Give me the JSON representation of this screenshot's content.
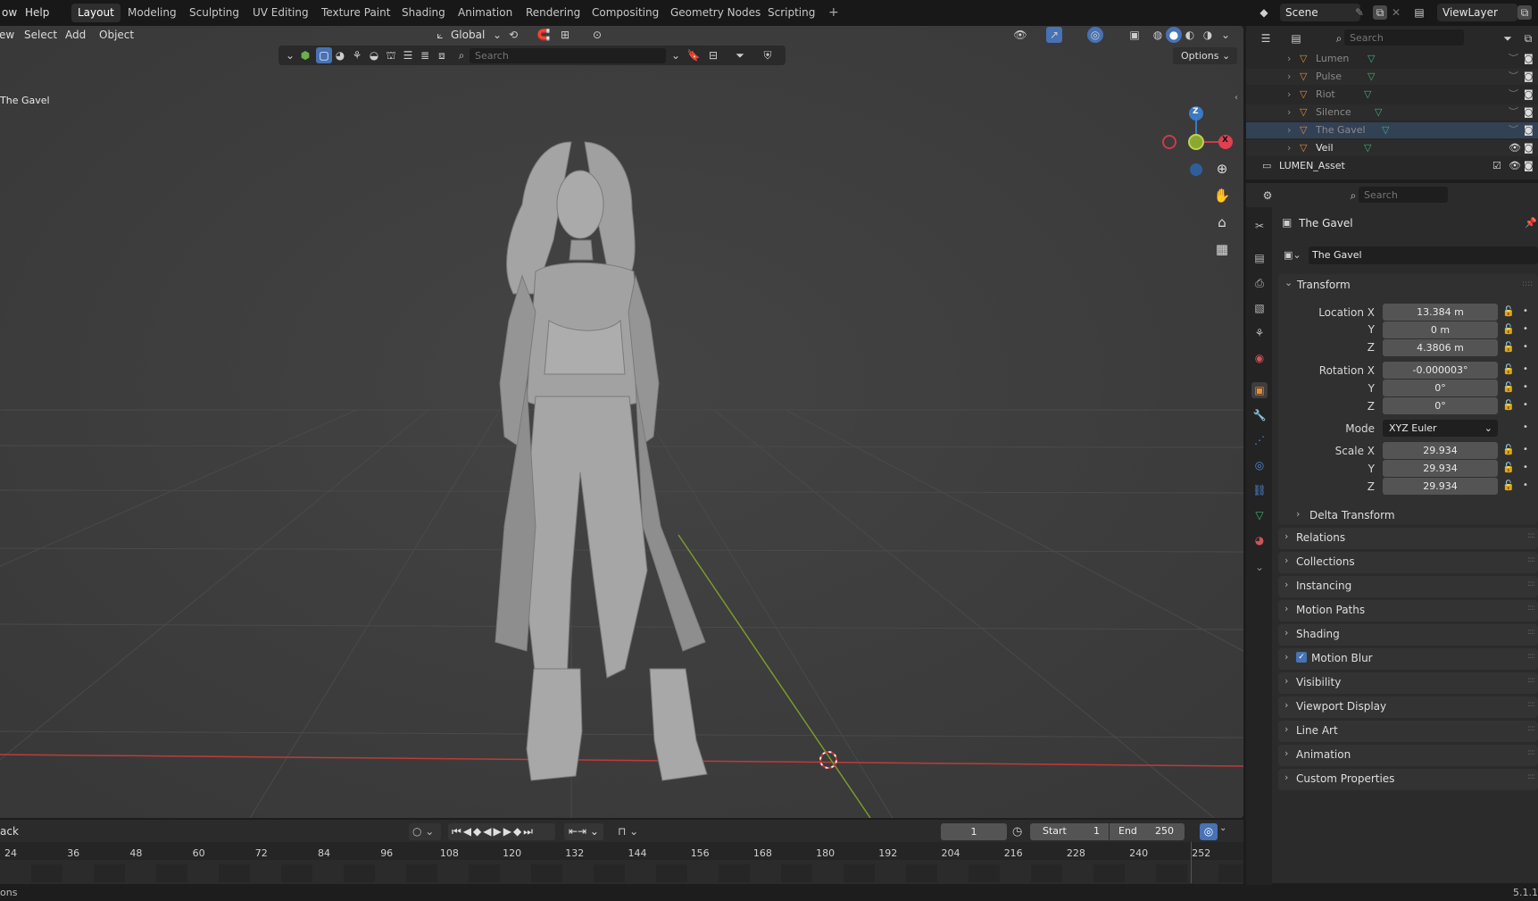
{
  "topbar": {
    "menu": [
      "ow",
      "Help"
    ],
    "workspaces": [
      "Layout",
      "Modeling",
      "Sculpting",
      "UV Editing",
      "Texture Paint",
      "Shading",
      "Animation",
      "Rendering",
      "Compositing",
      "Geometry Nodes",
      "Scripting"
    ],
    "add_tab": "+",
    "scene": "Scene",
    "view_layer": "ViewLayer"
  },
  "viewport": {
    "menu": [
      "ew",
      "Select",
      "Add",
      "Object"
    ],
    "orientation": "Global",
    "object_label": "The Gavel",
    "search_placeholder": "Search",
    "options_label": "Options",
    "gizmo": {
      "z": "Z",
      "x": "X"
    }
  },
  "outliner": {
    "search_placeholder": "Search",
    "items": [
      {
        "name": "Lumen"
      },
      {
        "name": "Pulse"
      },
      {
        "name": "Riot"
      },
      {
        "name": "Silence"
      },
      {
        "name": "The Gavel"
      },
      {
        "name": "Veil"
      }
    ],
    "collection": "LUMEN_Asset"
  },
  "properties": {
    "search_placeholder": "Search",
    "object_name": "The Gavel",
    "datablock_name": "The Gavel",
    "transform": {
      "title": "Transform",
      "location_label": "Location X",
      "location": [
        "13.384 m",
        "0 m",
        "4.3806 m"
      ],
      "rotation_label": "Rotation X",
      "rotation": [
        "-0.000003°",
        "0°",
        "0°"
      ],
      "mode_label": "Mode",
      "mode": "XYZ Euler",
      "scale_label": "Scale X",
      "scale": [
        "29.934",
        "29.934",
        "29.934"
      ],
      "y_label": "Y",
      "z_label": "Z",
      "delta": "Delta Transform"
    },
    "panels": [
      "Relations",
      "Collections",
      "Instancing",
      "Motion Paths",
      "Shading",
      "Motion Blur",
      "Visibility",
      "Viewport Display",
      "Line Art",
      "Animation",
      "Custom Properties"
    ]
  },
  "timeline": {
    "playback": "ack",
    "current_frame": "1",
    "start_label": "Start",
    "start": "1",
    "end_label": "End",
    "end": "250",
    "ticks": [
      "24",
      "36",
      "48",
      "60",
      "72",
      "84",
      "96",
      "108",
      "120",
      "132",
      "144",
      "156",
      "168",
      "180",
      "192",
      "204",
      "216",
      "228",
      "240",
      "252"
    ]
  },
  "status": {
    "left": "ons",
    "right": "5.1.1"
  }
}
